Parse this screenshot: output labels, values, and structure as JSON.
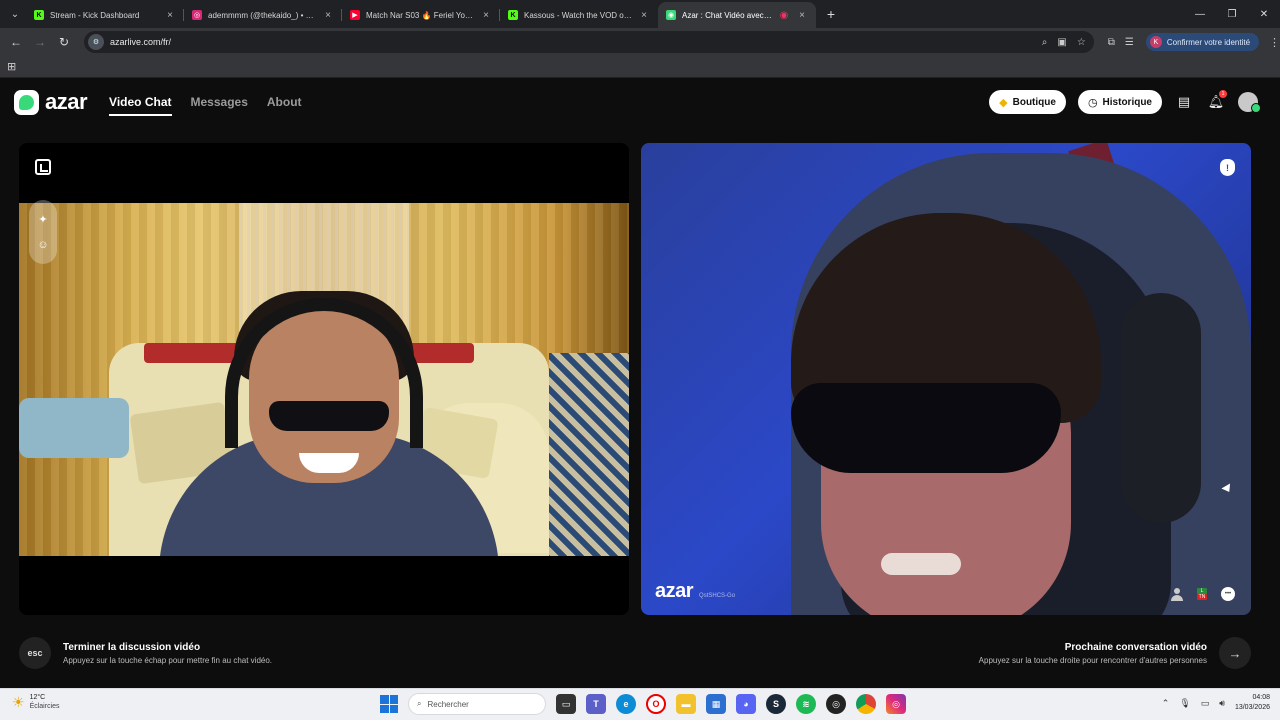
{
  "browser": {
    "tabs": [
      {
        "title": "Stream - Kick Dashboard",
        "favicon": "kick-icon",
        "color": "#53fc18",
        "active": false
      },
      {
        "title": "ademmmm (@thekaido_) • Pho",
        "favicon": "instagram-icon",
        "color": "#d62976",
        "active": false
      },
      {
        "title": "Match Nar S03 🔥 Feriel Youss",
        "favicon": "youtube-icon",
        "color": "#ff0033",
        "active": false
      },
      {
        "title": "Kassous - Watch the VOD on K",
        "favicon": "kick-icon",
        "color": "#53fc18",
        "active": false
      },
      {
        "title": "Azar : Chat Vidéo avec de n",
        "favicon": "azar-icon",
        "color": "#39d97a",
        "active": true
      }
    ],
    "url": "azarlive.com/fr/",
    "identity_button": "Confirmer votre identité",
    "identity_initial": "K"
  },
  "app": {
    "logo": "azar",
    "nav": [
      {
        "label": "Video Chat",
        "active": true
      },
      {
        "label": "Messages",
        "active": false
      },
      {
        "label": "About",
        "active": false
      }
    ],
    "boutique_label": "Boutique",
    "historique_label": "Historique",
    "notification_count": "1",
    "accent_color": "#39d97a"
  },
  "remote": {
    "watermark": "azar",
    "watermark_id": "QstSHCS-Go",
    "lang_top": "L",
    "lang_bottom": "TN"
  },
  "hints": {
    "esc_key": "esc",
    "end_title": "Terminer la discussion vidéo",
    "end_sub": "Appuyez sur la touche échap pour mettre fin au chat vidéo.",
    "next_title": "Prochaine conversation vidéo",
    "next_sub": "Appuyez sur la touche droite pour rencontrer d'autres personnes"
  },
  "taskbar": {
    "temperature": "12°C",
    "condition": "Éclaircies",
    "search_placeholder": "Rechercher",
    "time": "04:08",
    "date": "13/03/2026"
  }
}
